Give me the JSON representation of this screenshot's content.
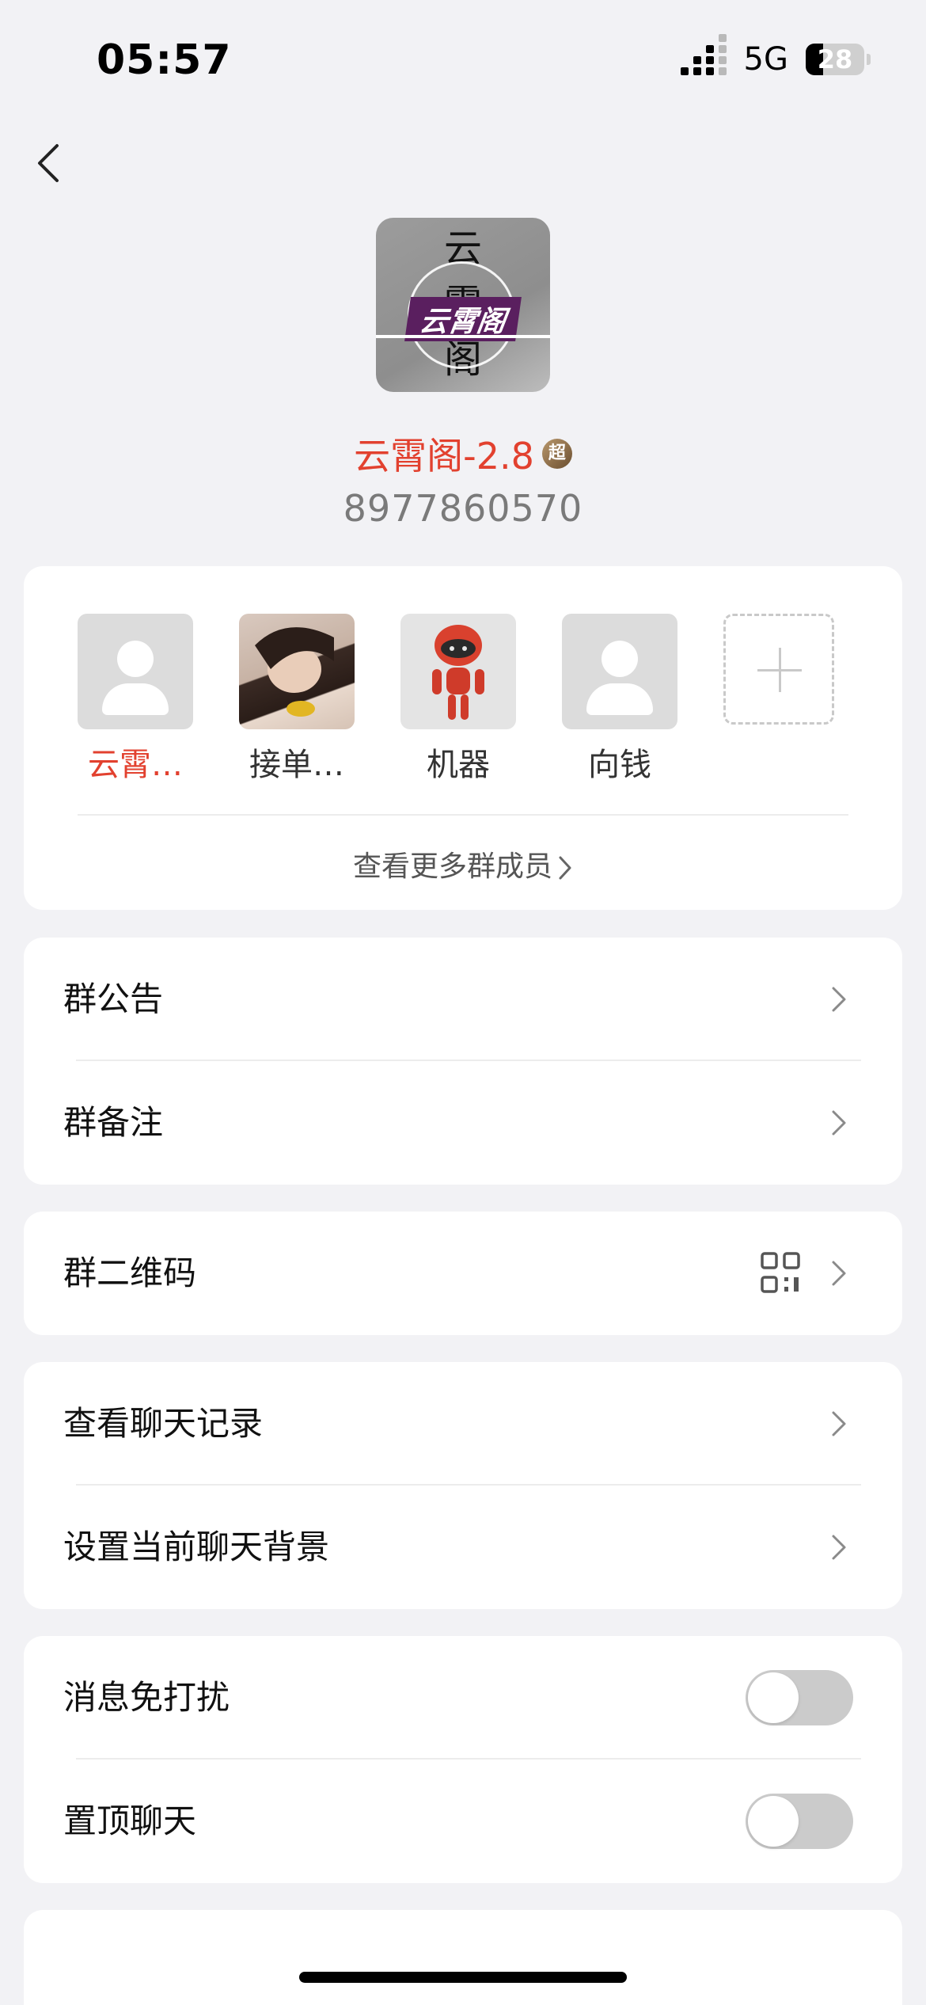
{
  "status_bar": {
    "time": "05:57",
    "network": "5G",
    "battery": "28"
  },
  "group": {
    "avatar_text": [
      "云",
      "霄",
      "阁"
    ],
    "avatar_logo": "云霄阁",
    "name": "云霄阁-2.8",
    "super_badge": "超",
    "id": "8977860570"
  },
  "members": [
    {
      "name": "云霄…",
      "avatar": "default-person",
      "highlight": true
    },
    {
      "name": "接单…",
      "avatar": "photo"
    },
    {
      "name": "机器",
      "avatar": "red-robot"
    },
    {
      "name": "向钱",
      "avatar": "default-person"
    }
  ],
  "more_members_label": "查看更多群成员",
  "menu": {
    "announcement": "群公告",
    "remark": "群备注",
    "qr_code": "群二维码",
    "chat_history": "查看聊天记录",
    "chat_background": "设置当前聊天背景",
    "do_not_disturb": "消息免打扰",
    "pin_chat": "置顶聊天"
  },
  "toggles": {
    "do_not_disturb": false,
    "pin_chat": false
  },
  "colors": {
    "accent_red": "#E2412F",
    "background": "#F2F2F5"
  }
}
